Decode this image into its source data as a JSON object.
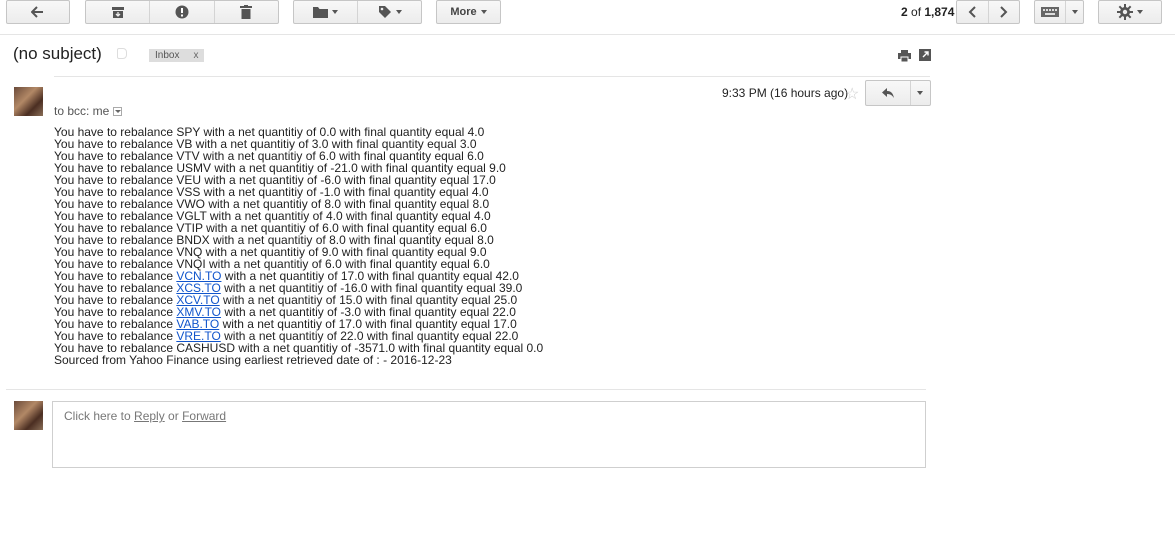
{
  "toolbar": {
    "more_label": "More",
    "count_current": "2",
    "count_of": " of ",
    "count_total": "1,874"
  },
  "message": {
    "subject": "(no subject)",
    "label_chip": "Inbox",
    "label_chip_close": "x",
    "to_line": "to bcc: me",
    "time": "9:33 PM (16 hours ago)",
    "body_lines": [
      {
        "pre": "You have to rebalance SPY with a net quantitiy of 0.0 with final quantity equal 4.0"
      },
      {
        "pre": "You have to rebalance VB with a net quantitiy of 3.0 with final quantity equal 3.0"
      },
      {
        "pre": "You have to rebalance VTV with a net quantitiy of 6.0 with final quantity equal 6.0"
      },
      {
        "pre": "You have to rebalance USMV with a net quantitiy of -21.0 with final quantity equal 9.0"
      },
      {
        "pre": "You have to rebalance VEU with a net quantitiy of -6.0 with final quantity equal 17.0"
      },
      {
        "pre": "You have to rebalance VSS with a net quantitiy of -1.0 with final quantity equal 4.0"
      },
      {
        "pre": "You have to rebalance VWO with a net quantitiy of 8.0 with final quantity equal 8.0"
      },
      {
        "pre": "You have to rebalance VGLT with a net quantitiy of 4.0 with final quantity equal 4.0"
      },
      {
        "pre": "You have to rebalance VTIP with a net quantitiy of 6.0 with final quantity equal 6.0"
      },
      {
        "pre": "You have to rebalance BNDX with a net quantitiy of 8.0 with final quantity equal 8.0"
      },
      {
        "pre": "You have to rebalance VNQ with a net quantitiy of 9.0 with final quantity equal 9.0"
      },
      {
        "pre": "You have to rebalance VNQI with a net quantitiy of 6.0 with final quantity equal 6.0"
      },
      {
        "pre": "You have to rebalance ",
        "link": "VCN.TO",
        "post": " with a net quantitiy of 17.0 with final quantity equal 42.0"
      },
      {
        "pre": "You have to rebalance ",
        "link": "XCS.TO",
        "post": " with a net quantitiy of -16.0 with final quantity equal 39.0"
      },
      {
        "pre": "You have to rebalance ",
        "link": "XCV.TO",
        "post": " with a net quantitiy of 15.0 with final quantity equal 25.0"
      },
      {
        "pre": "You have to rebalance ",
        "link": "XMV.TO",
        "post": " with a net quantitiy of -3.0 with final quantity equal 22.0"
      },
      {
        "pre": "You have to rebalance ",
        "link": "VAB.TO",
        "post": " with a net quantitiy of 17.0 with final quantity equal 17.0"
      },
      {
        "pre": "You have to rebalance ",
        "link": "VRE.TO",
        "post": " with a net quantitiy of 22.0 with final quantity equal 22.0"
      },
      {
        "pre": "You have to rebalance CASHUSD with a net quantitiy of -3571.0 with final quantity equal 0.0"
      },
      {
        "pre": "Sourced from Yahoo Finance using earliest retrieved date of :  - 2016-12-23"
      }
    ]
  },
  "reply": {
    "prefix": "Click here to ",
    "reply_link": "Reply",
    "or": " or ",
    "forward_link": "Forward"
  },
  "icons": [
    "back-arrow-icon",
    "archive-icon",
    "spam-icon",
    "trash-icon",
    "folder-icon",
    "tag-icon",
    "chevron-left-icon",
    "chevron-right-icon",
    "keyboard-icon",
    "gear-icon",
    "print-icon",
    "new-window-icon",
    "star-icon",
    "reply-icon"
  ]
}
